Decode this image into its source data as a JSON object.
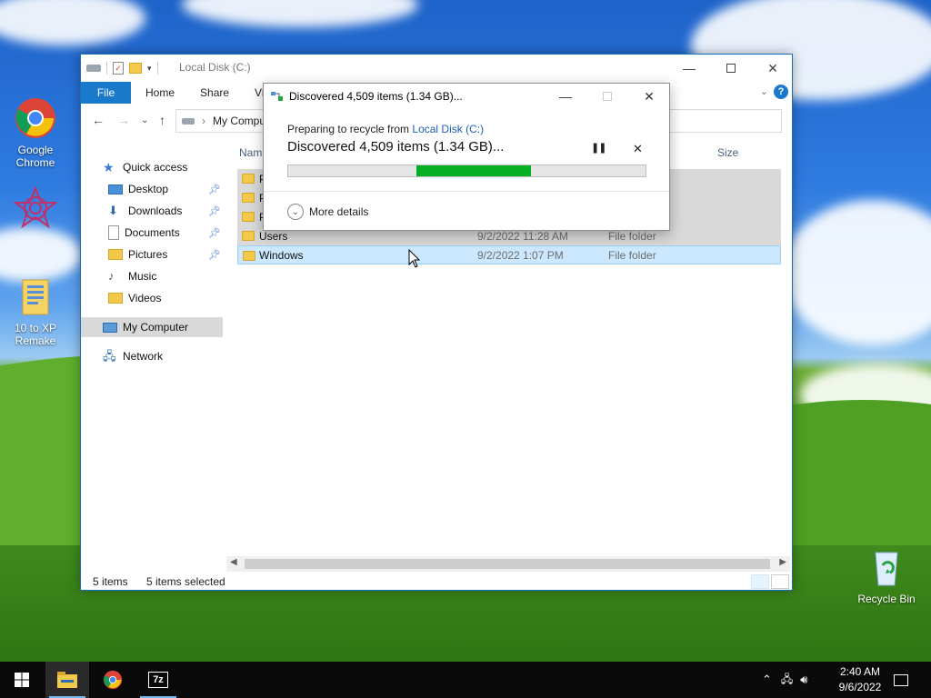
{
  "desktop": {
    "icons": [
      {
        "label": "Google Chrome",
        "icon": "chrome-icon"
      },
      {
        "label": "",
        "icon": "app-icon"
      },
      {
        "label": "10 to XP Remake",
        "icon": "folder-icon"
      },
      {
        "label": "Recycle Bin",
        "icon": "recycle-bin-icon"
      }
    ]
  },
  "explorer": {
    "title": "Local Disk (C:)",
    "ribbon": {
      "file": "File",
      "tabs": [
        "Home",
        "Share",
        "View"
      ]
    },
    "address": {
      "path": "My Computer"
    },
    "nav": {
      "quick_access": "Quick access",
      "items": [
        "Desktop",
        "Downloads",
        "Documents",
        "Pictures",
        "Music",
        "Videos"
      ],
      "my_computer": "My Computer",
      "network": "Network"
    },
    "columns": {
      "name": "Name",
      "size": "Size"
    },
    "rows": [
      {
        "name": "P",
        "date": "",
        "type": ""
      },
      {
        "name": "P",
        "date": "",
        "type": ""
      },
      {
        "name": "P",
        "date": "",
        "type": ""
      },
      {
        "name": "Users",
        "date": "9/2/2022 11:28 AM",
        "type": "File folder"
      },
      {
        "name": "Windows",
        "date": "9/2/2022 1:07 PM",
        "type": "File folder"
      }
    ],
    "status": {
      "count": "5 items",
      "selected": "5 items selected"
    }
  },
  "dialog": {
    "title": "Discovered 4,509 items (1.34 GB)...",
    "from_prefix": "Preparing to recycle from",
    "from_link": "Local Disk (C:)",
    "status": "Discovered 4,509 items (1.34 GB)...",
    "progress_start": 0.36,
    "progress_end": 0.68,
    "more_details": "More details"
  },
  "taskbar": {
    "apps": [
      "start-button",
      "file-explorer",
      "chrome",
      "7zip"
    ],
    "sevenzip_label": "7z",
    "time": "2:40 AM",
    "date": "9/6/2022"
  },
  "colors": {
    "accent": "#1979ca",
    "progress": "#06b025",
    "selection": "#cce8ff"
  }
}
